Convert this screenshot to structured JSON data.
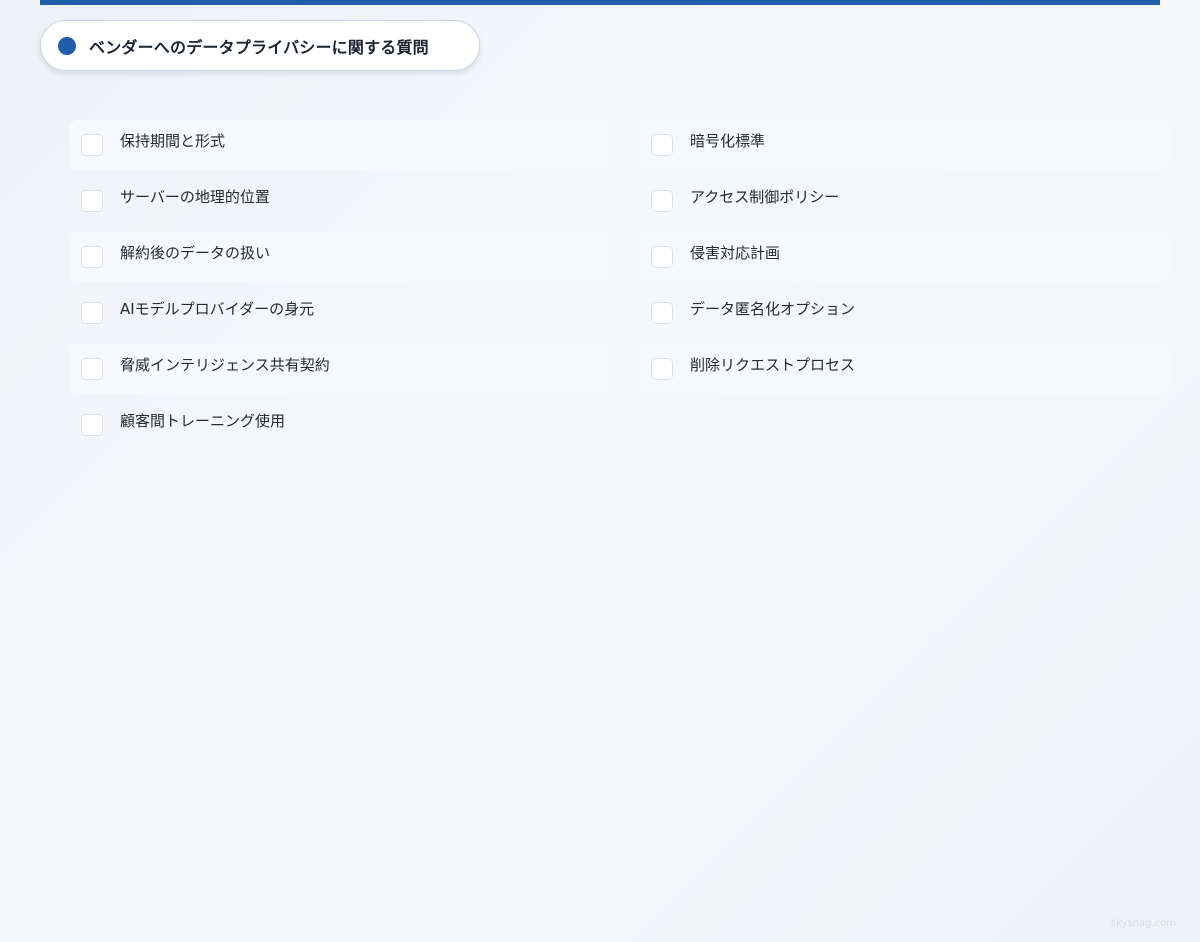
{
  "header": {
    "title": "ベンダーへのデータプライバシーに関する質問"
  },
  "checklist": {
    "items": [
      {
        "label": "保持期間と形式",
        "checked": false
      },
      {
        "label": "暗号化標準",
        "checked": false
      },
      {
        "label": "サーバーの地理的位置",
        "checked": false
      },
      {
        "label": "アクセス制御ポリシー",
        "checked": false
      },
      {
        "label": "解約後のデータの扱い",
        "checked": false
      },
      {
        "label": "侵害対応計画",
        "checked": false
      },
      {
        "label": "AIモデルプロバイダーの身元",
        "checked": false
      },
      {
        "label": "データ匿名化オプション",
        "checked": false
      },
      {
        "label": "脅威インテリジェンス共有契約",
        "checked": false
      },
      {
        "label": "削除リクエストプロセス",
        "checked": false
      },
      {
        "label": "顧客間トレーニング使用",
        "checked": false
      }
    ]
  },
  "footer": {
    "watermark": "skysnag.com"
  },
  "colors": {
    "accent": "#1f5ea8",
    "checkbox_border": "#dde2ea"
  }
}
